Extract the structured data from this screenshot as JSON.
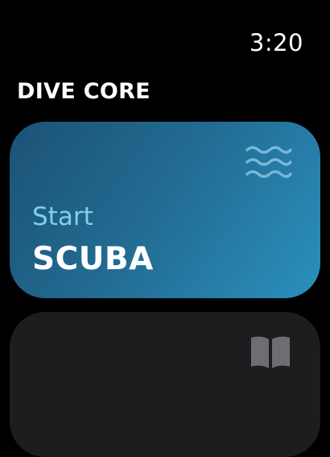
{
  "status": {
    "time": "3:20"
  },
  "app": {
    "title": "DIVE CORE"
  },
  "cards": {
    "scuba": {
      "subtitle": "Start",
      "title": "SCUBA",
      "icon": "waves-icon",
      "accent_color": "#7fd0ee",
      "gradient_start": "#1c5276",
      "gradient_end": "#2a90bd"
    },
    "log": {
      "icon": "book-icon",
      "background_color": "#1d1d20"
    }
  }
}
